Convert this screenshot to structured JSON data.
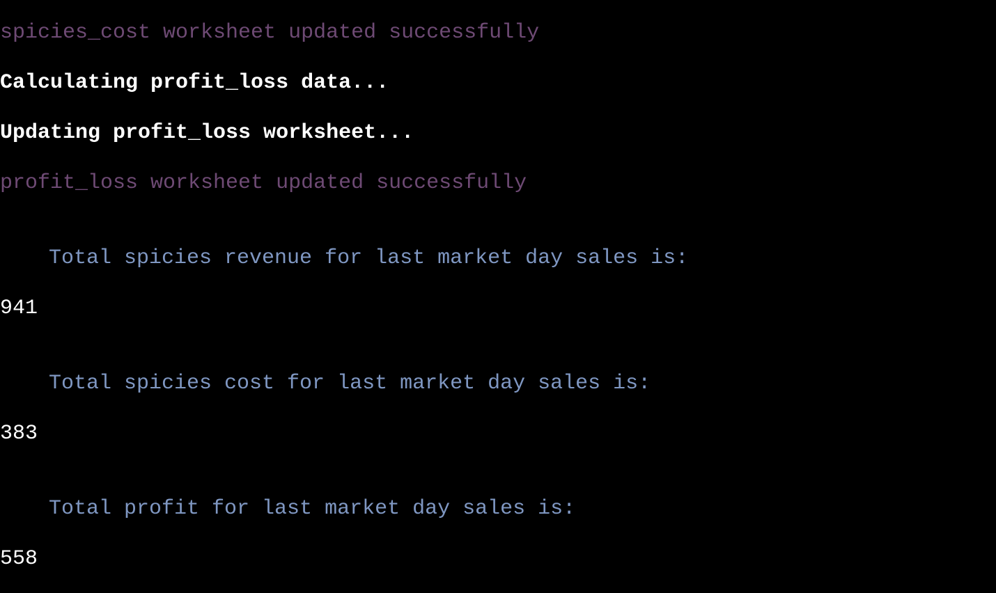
{
  "terminal": {
    "lines": {
      "spicies_cost_updated": "spicies_cost worksheet updated successfully",
      "calculating_profit_loss": "Calculating profit_loss data...",
      "updating_profit_loss": "Updating profit_loss worksheet...",
      "profit_loss_updated": "profit_loss worksheet updated successfully"
    },
    "summary": {
      "revenue_label": "Total spicies revenue for last market day sales is:",
      "revenue_value": "941",
      "cost_label": "Total spicies cost for last market day sales is:",
      "cost_value": "383",
      "profit_label": "Total profit for last market day sales is:",
      "profit_value": "558"
    },
    "colors": {
      "background": "#000000",
      "success_text": "#6e4a74",
      "status_text": "#ffffff",
      "label_text": "#7f97c2",
      "value_text": "#ffffff"
    }
  }
}
